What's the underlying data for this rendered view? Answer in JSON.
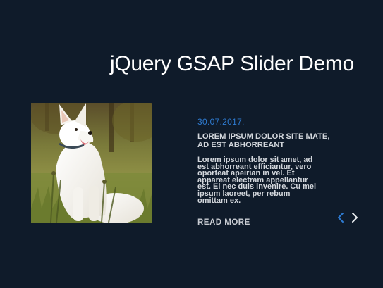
{
  "header": {
    "title": "jQuery GSAP Slider Demo"
  },
  "slide": {
    "image_subject": "white dog sitting in grass",
    "date": "30.07.2017.",
    "heading": "LOREM IPSUM DOLOR SITE MATE, AD EST ABHORREANT",
    "body": "Lorem ipsum dolor sit amet, ad est abhorreant efficiantur, vero oporteat apeirian in vel. Et appareat electram appellantur est. Ei nec duis invenire. Cu mel ipsum laoreet, per rebum omittam ex.",
    "read_more_label": "READ MORE"
  },
  "nav": {
    "prev_icon": "chevron-left-icon",
    "next_icon": "chevron-right-icon"
  },
  "colors": {
    "background": "#0f1b2a",
    "accent": "#2e7bd1",
    "text": "#d3d7dc",
    "title": "#ffffff"
  }
}
